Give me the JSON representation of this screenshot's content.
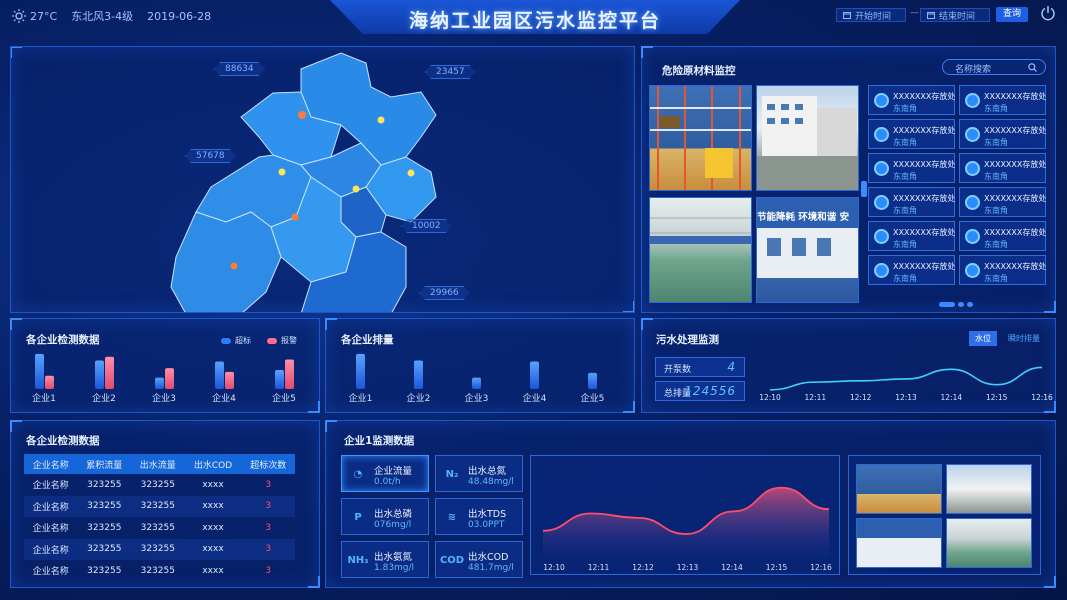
{
  "header": {
    "temperature": "27°C",
    "wind": "东北风3-4级",
    "date": "2019-06-28",
    "title": "海纳工业园区污水监控平台",
    "start_placeholder": "开始时间",
    "separator": "—",
    "end_placeholder": "结束时间",
    "query_label": "查询"
  },
  "map": {
    "tags": [
      "88634",
      "23457",
      "57678",
      "10002",
      "29966"
    ]
  },
  "materials": {
    "title": "危险原材料监控",
    "search_placeholder": "名称搜索",
    "cards": [
      {
        "name": "XXXXXXX存放处",
        "loc": "东南角"
      },
      {
        "name": "XXXXXXX存放处",
        "loc": "东南角"
      },
      {
        "name": "XXXXXXX存放处",
        "loc": "东南角"
      },
      {
        "name": "XXXXXXX存放处",
        "loc": "东南角"
      },
      {
        "name": "XXXXXXX存放处",
        "loc": "东南角"
      },
      {
        "name": "XXXXXXX存放处",
        "loc": "东南角"
      },
      {
        "name": "XXXXXXX存放处",
        "loc": "东南角"
      },
      {
        "name": "XXXXXXX存放处",
        "loc": "东南角"
      },
      {
        "name": "XXXXXXX存放处",
        "loc": "东南角"
      },
      {
        "name": "XXXXXXX存放处",
        "loc": "东南角"
      },
      {
        "name": "XXXXXXX存放处",
        "loc": "东南角"
      },
      {
        "name": "XXXXXXX存放处",
        "loc": "东南角"
      }
    ],
    "photo_text": "节能降耗 环境和谐 安"
  },
  "detect": {
    "title": "各企业检测数据",
    "legend_a": "超标",
    "legend_b": "报警"
  },
  "emission": {
    "title": "各企业排量"
  },
  "sewage": {
    "title": "污水处理监测",
    "tab_active": "水位",
    "tab_other": "瞬时排量",
    "pump_label": "开泵数",
    "pump_value": "4",
    "total_label": "总排量",
    "total_value": "124556"
  },
  "table": {
    "title": "各企业检测数据",
    "headers": [
      "企业名称",
      "累积流量",
      "出水流量",
      "出水COD",
      "超标次数"
    ],
    "rows": [
      [
        "企业名称",
        "323255",
        "323255",
        "xxxx",
        "3"
      ],
      [
        "企业名称",
        "323255",
        "323255",
        "xxxx",
        "3"
      ],
      [
        "企业名称",
        "323255",
        "323255",
        "xxxx",
        "3"
      ],
      [
        "企业名称",
        "323255",
        "323255",
        "xxxx",
        "3"
      ],
      [
        "企业名称",
        "323255",
        "323255",
        "xxxx",
        "3"
      ]
    ]
  },
  "monitor": {
    "title": "企业1监测数据",
    "metrics": [
      {
        "icon": "flow-icon",
        "glyph": "◔",
        "label": "企业流量",
        "value": "0.0t/h"
      },
      {
        "icon": "n2-icon",
        "glyph": "N₂",
        "label": "出水总氮",
        "value": "48.48mg/l"
      },
      {
        "icon": "phosphorus-icon",
        "glyph": "P",
        "label": "出水总磷",
        "value": "076mg/l"
      },
      {
        "icon": "tds-icon",
        "glyph": "≋",
        "label": "出水TDS",
        "value": "03.0PPT"
      },
      {
        "icon": "nh3-icon",
        "glyph": "NH₃",
        "label": "出水氨氮",
        "value": "1.83mg/l"
      },
      {
        "icon": "cod-icon",
        "glyph": "COD",
        "label": "出水COD",
        "value": "481.7mg/l"
      }
    ]
  },
  "chart_data": [
    {
      "type": "bar",
      "title": "各企业检测数据",
      "categories": [
        "企业1",
        "企业2",
        "企业3",
        "企业4",
        "企业5"
      ],
      "series": [
        {
          "name": "超标",
          "values": [
            37,
            30,
            12,
            29,
            20
          ],
          "color": "#2f7cff"
        },
        {
          "name": "报警",
          "values": [
            14,
            34,
            22,
            18,
            31
          ],
          "color": "#ff6f8e"
        }
      ],
      "ylim": [
        0,
        40
      ]
    },
    {
      "type": "bar",
      "title": "各企业排量",
      "categories": [
        "企业1",
        "企业2",
        "企业3",
        "企业4",
        "企业5"
      ],
      "values": [
        37,
        30,
        12,
        29,
        17
      ],
      "ylim": [
        0,
        40
      ]
    },
    {
      "type": "line",
      "title": "污水处理监测",
      "x": [
        "12:10",
        "12:11",
        "12:12",
        "12:13",
        "12:14",
        "12:15",
        "12:16"
      ],
      "values": [
        30,
        42,
        44,
        47,
        62,
        38,
        65
      ],
      "ylim": [
        0,
        100
      ]
    },
    {
      "type": "area",
      "title": "企业1监测数据",
      "x": [
        "12:10",
        "12:11",
        "12:12",
        "12:13",
        "12:14",
        "12:15",
        "12:16"
      ],
      "values": [
        40,
        56,
        52,
        37,
        58,
        80,
        60
      ],
      "ylim": [
        0,
        100
      ]
    }
  ]
}
